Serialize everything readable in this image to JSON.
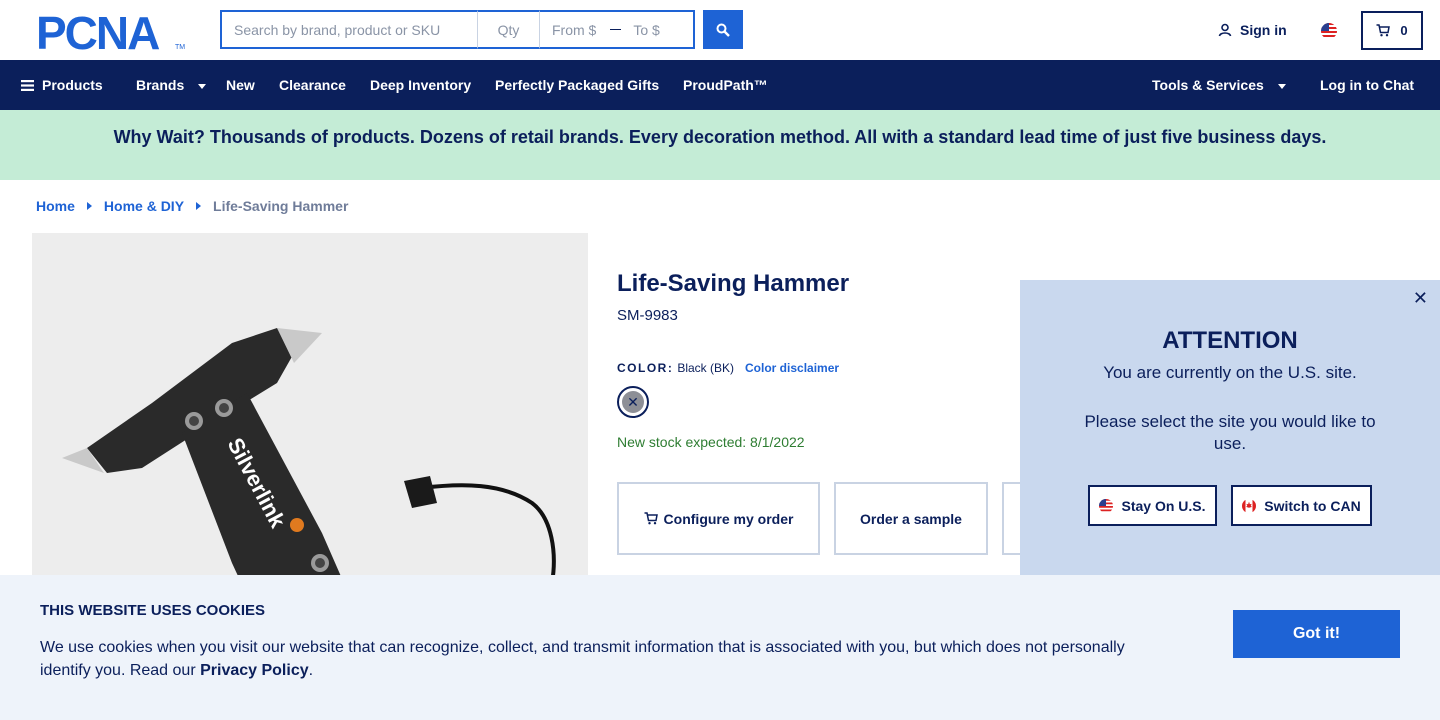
{
  "header": {
    "logo_text": "PCNA",
    "search_placeholder": "Search by brand, product or SKU",
    "qty_placeholder": "Qty",
    "from_placeholder": "From $",
    "to_placeholder": "To $",
    "signin_label": "Sign in",
    "cart_count": "0"
  },
  "nav": {
    "products": "Products",
    "brands": "Brands",
    "new": "New",
    "clearance": "Clearance",
    "deep_inventory": "Deep Inventory",
    "gifts": "Perfectly Packaged Gifts",
    "proudpath": "ProudPath™",
    "tools": "Tools & Services",
    "chat": "Log in to Chat"
  },
  "promo": "Why Wait? Thousands of products. Dozens of retail brands. Every decoration method. All with a standard lead time of just five business days.",
  "breadcrumb": {
    "home": "Home",
    "category": "Home & DIY",
    "current": "Life-Saving Hammer"
  },
  "product": {
    "title": "Life-Saving Hammer",
    "sku": "SM-9983",
    "color_label": "COLOR:",
    "color_value": "Black (BK)",
    "color_disclaimer": "Color disclaimer",
    "stock": "New stock expected: 8/1/2022",
    "image_brand": "Silverlink",
    "configure_label": "Configure my order",
    "sample_label": "Order a sample"
  },
  "modal": {
    "title": "ATTENTION",
    "line1": "You are currently on the U.S. site.",
    "line2": "Please select the site you would like to use.",
    "stay_label": "Stay On U.S.",
    "switch_label": "Switch to CAN"
  },
  "cookie": {
    "title": "THIS WEBSITE USES COOKIES",
    "text_before": "We use cookies when you visit our website that can recognize, collect, and transmit information that is associated with you, but which does not personally identify you. Read our ",
    "link": "Privacy Policy",
    "text_after": ".",
    "button": "Got it!"
  },
  "colors": {
    "navy": "#0b1f5b",
    "accent": "#1e63d5",
    "promo_bg": "#c4ecd6",
    "modal_bg": "#c9d8ee",
    "cookie_bg": "#eef3fa"
  }
}
